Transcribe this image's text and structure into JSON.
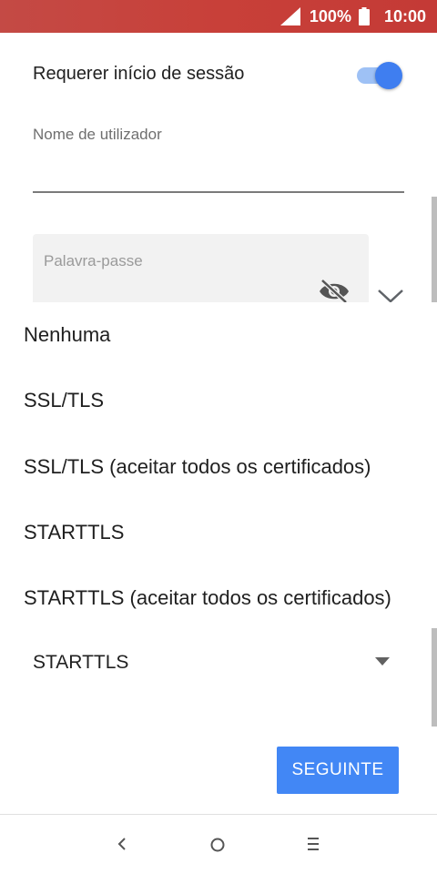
{
  "status_bar": {
    "battery_percent": "100%",
    "time": "10:00",
    "icons": [
      "signal-icon",
      "battery-icon"
    ],
    "background_color": "#c84039"
  },
  "settings": {
    "require_login": {
      "label": "Requerer início de sessão",
      "enabled": true
    },
    "username": {
      "label": "Nome de utilizador",
      "value": ""
    },
    "password": {
      "placeholder": "Palavra-passe",
      "value": ""
    },
    "security": {
      "selected": "STARTTLS"
    }
  },
  "dropdown": {
    "options": [
      "Nenhuma",
      "SSL/TLS",
      "SSL/TLS (aceitar todos os certificados)",
      "STARTTLS",
      "STARTTLS (aceitar todos os certificados)"
    ]
  },
  "actions": {
    "next_label": "SEGUINTE"
  },
  "colors": {
    "accent": "#4287f5",
    "toggle_thumb": "#3f7ef0",
    "toggle_track": "#9ec1f5"
  },
  "nav_bar": {
    "icons": [
      "back-icon",
      "home-icon",
      "recents-icon"
    ]
  }
}
